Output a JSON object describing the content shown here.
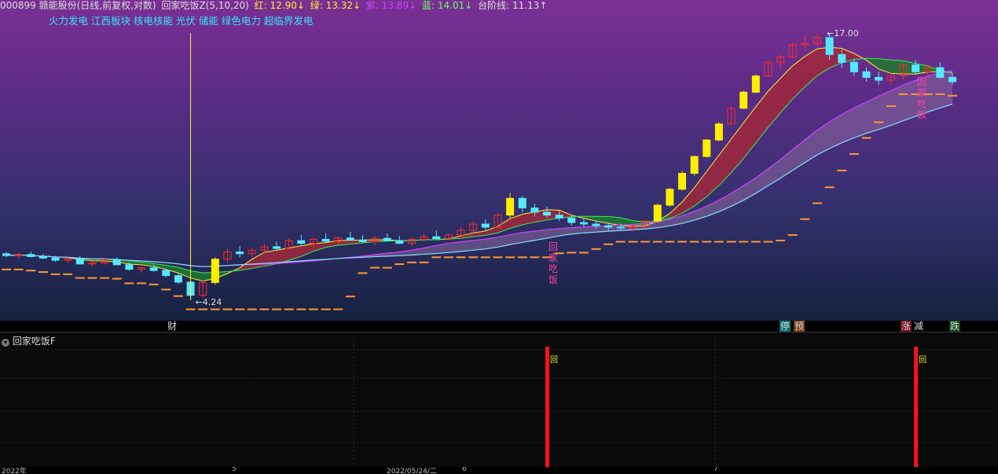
{
  "header": {
    "stock": "000899 赣能股份(日线,前复权,对数)",
    "indicator": "回家吃饭Z(5,10,20)",
    "red": "红: 12.90↓",
    "green": "绿: 13.32↓",
    "purple": "紫: 13.89↓",
    "blue": "蓝: 14.01↓",
    "step": "台阶线: 11.13↑"
  },
  "concepts": "火力发电 江西板块 核电核能 光伏 储能 绿色电力 超临界发电",
  "annotations": {
    "low_label": "4.24",
    "high_label": "17.00",
    "signal_text": [
      "回",
      "家",
      "吃",
      "饭"
    ]
  },
  "markers": [
    {
      "text": "财",
      "color": "#66ccff"
    },
    {
      "text": "停",
      "color": "#66ffcc"
    },
    {
      "text": "预",
      "color": "#ff9933"
    },
    {
      "text": "涨",
      "color": "#ff4455"
    },
    {
      "text": "减",
      "color": "#66ff66"
    },
    {
      "text": "跌",
      "color": "#33ff66"
    }
  ],
  "sub_panel": {
    "title": "回家吃饭F",
    "signal_char": "回"
  },
  "time_axis": [
    "2022年",
    "5",
    "2022/05/24/二",
    "6",
    "7"
  ],
  "colors": {
    "up": "#ff2a2a",
    "down": "#55e8ff",
    "limit_up": "#ffee00",
    "red_line": "#ffee33",
    "green_line": "#33ee55",
    "purple_line": "#cc44ff",
    "blue_line": "#88ddff",
    "step_line": "#ff9933",
    "signal": "#ff1111"
  },
  "chart_data": {
    "type": "candlestick",
    "title": "000899 赣能股份(日线,前复权,对数)",
    "y_scale": "log",
    "ohlc": [
      [
        5.4,
        5.45,
        5.3,
        5.35
      ],
      [
        5.35,
        5.42,
        5.28,
        5.38
      ],
      [
        5.38,
        5.46,
        5.3,
        5.32
      ],
      [
        5.32,
        5.4,
        5.25,
        5.28
      ],
      [
        5.28,
        5.34,
        5.18,
        5.22
      ],
      [
        5.22,
        5.3,
        5.15,
        5.26
      ],
      [
        5.26,
        5.33,
        5.1,
        5.12
      ],
      [
        5.12,
        5.2,
        5.05,
        5.15
      ],
      [
        5.15,
        5.28,
        5.1,
        5.24
      ],
      [
        5.24,
        5.3,
        5.08,
        5.1
      ],
      [
        5.1,
        5.16,
        4.95,
        4.98
      ],
      [
        4.98,
        5.06,
        4.9,
        5.02
      ],
      [
        5.02,
        5.1,
        4.92,
        4.95
      ],
      [
        4.95,
        5.0,
        4.78,
        4.82
      ],
      [
        4.82,
        4.9,
        4.62,
        4.66
      ],
      [
        4.66,
        4.72,
        4.24,
        4.35
      ],
      [
        4.35,
        4.7,
        4.3,
        4.65
      ],
      [
        4.65,
        5.3,
        4.6,
        5.25
      ],
      [
        5.25,
        5.55,
        5.15,
        5.45
      ],
      [
        5.45,
        5.62,
        5.3,
        5.4
      ],
      [
        5.4,
        5.58,
        5.3,
        5.5
      ],
      [
        5.5,
        5.7,
        5.4,
        5.6
      ],
      [
        5.6,
        5.75,
        5.48,
        5.55
      ],
      [
        5.55,
        5.85,
        5.5,
        5.78
      ],
      [
        5.78,
        5.95,
        5.65,
        5.7
      ],
      [
        5.7,
        5.88,
        5.6,
        5.82
      ],
      [
        5.82,
        6.0,
        5.72,
        5.76
      ],
      [
        5.76,
        5.9,
        5.66,
        5.86
      ],
      [
        5.86,
        6.05,
        5.78,
        5.8
      ],
      [
        5.8,
        5.95,
        5.7,
        5.75
      ],
      [
        5.75,
        5.92,
        5.65,
        5.85
      ],
      [
        5.85,
        6.0,
        5.75,
        5.78
      ],
      [
        5.78,
        5.92,
        5.68,
        5.7
      ],
      [
        5.7,
        5.88,
        5.62,
        5.82
      ],
      [
        5.82,
        5.98,
        5.75,
        5.9
      ],
      [
        5.9,
        6.1,
        5.82,
        5.84
      ],
      [
        5.84,
        6.0,
        5.78,
        5.95
      ],
      [
        5.95,
        6.2,
        5.9,
        6.1
      ],
      [
        6.1,
        6.4,
        6.05,
        6.3
      ],
      [
        6.3,
        6.45,
        6.1,
        6.2
      ],
      [
        6.2,
        6.7,
        6.15,
        6.6
      ],
      [
        6.6,
        7.4,
        6.5,
        7.2
      ],
      [
        7.2,
        7.3,
        6.7,
        6.85
      ],
      [
        6.85,
        7.0,
        6.55,
        6.7
      ],
      [
        6.7,
        6.9,
        6.5,
        6.6
      ],
      [
        6.6,
        6.75,
        6.4,
        6.5
      ],
      [
        6.5,
        6.62,
        6.25,
        6.35
      ],
      [
        6.35,
        6.5,
        6.2,
        6.3
      ],
      [
        6.3,
        6.42,
        6.15,
        6.25
      ],
      [
        6.25,
        6.36,
        6.1,
        6.2
      ],
      [
        6.2,
        6.32,
        6.08,
        6.18
      ],
      [
        6.18,
        6.3,
        6.05,
        6.22
      ],
      [
        6.22,
        6.45,
        6.15,
        6.4
      ],
      [
        6.4,
        7.0,
        6.35,
        6.95
      ],
      [
        6.95,
        7.6,
        6.9,
        7.55
      ],
      [
        7.55,
        8.3,
        7.5,
        8.2
      ],
      [
        8.2,
        9.0,
        8.1,
        8.95
      ],
      [
        8.95,
        9.8,
        8.9,
        9.75
      ],
      [
        9.75,
        10.7,
        9.7,
        10.6
      ],
      [
        10.6,
        11.6,
        10.55,
        11.5
      ],
      [
        11.5,
        12.6,
        11.45,
        12.5
      ],
      [
        12.5,
        13.7,
        12.45,
        13.6
      ],
      [
        13.6,
        14.8,
        13.55,
        14.6
      ],
      [
        14.6,
        15.2,
        14.0,
        15.0
      ],
      [
        15.0,
        16.2,
        14.9,
        16.0
      ],
      [
        16.0,
        16.8,
        15.5,
        16.1
      ],
      [
        16.1,
        17.0,
        15.9,
        16.6
      ],
      [
        16.6,
        16.9,
        14.8,
        15.2
      ],
      [
        15.2,
        15.6,
        14.2,
        14.6
      ],
      [
        14.6,
        14.9,
        13.6,
        13.9
      ],
      [
        13.9,
        14.2,
        13.2,
        13.5
      ],
      [
        13.5,
        13.9,
        13.0,
        13.3
      ],
      [
        13.3,
        13.8,
        13.1,
        13.6
      ],
      [
        13.6,
        14.6,
        13.4,
        14.4
      ],
      [
        14.4,
        14.8,
        13.7,
        13.9
      ],
      [
        13.9,
        14.5,
        13.6,
        14.2
      ],
      [
        14.2,
        14.6,
        13.4,
        13.5
      ],
      [
        13.5,
        13.8,
        13.0,
        13.2
      ]
    ],
    "annotations": {
      "low": 4.24,
      "high": 17.0
    },
    "last_values": {
      "red": 12.9,
      "green": 13.32,
      "purple": 13.89,
      "blue": 14.01,
      "step": 11.13
    }
  }
}
